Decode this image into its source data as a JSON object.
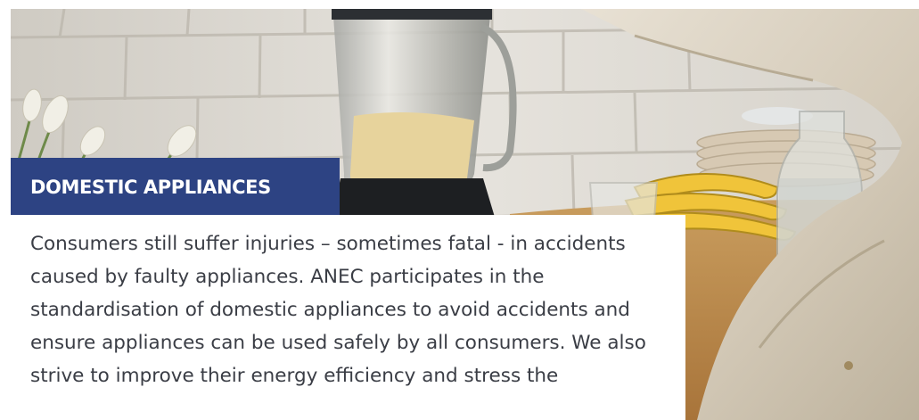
{
  "section": {
    "title": "DOMESTIC APPLIANCES",
    "body_text": "Consumers still suffer injuries – sometimes fatal - in accidents caused by faulty appliances. ANEC participates in the standardisation of domestic appliances to avoid accidents and ensure appliances can be used safely by all consumers. We also strive to improve their energy efficiency and stress the"
  },
  "colors": {
    "banner_background": "#2d4383",
    "banner_text": "#ffffff",
    "body_text": "#3a3d45",
    "page_background": "#ffffff"
  },
  "photo": {
    "subject": "kitchen-blender-photo"
  }
}
